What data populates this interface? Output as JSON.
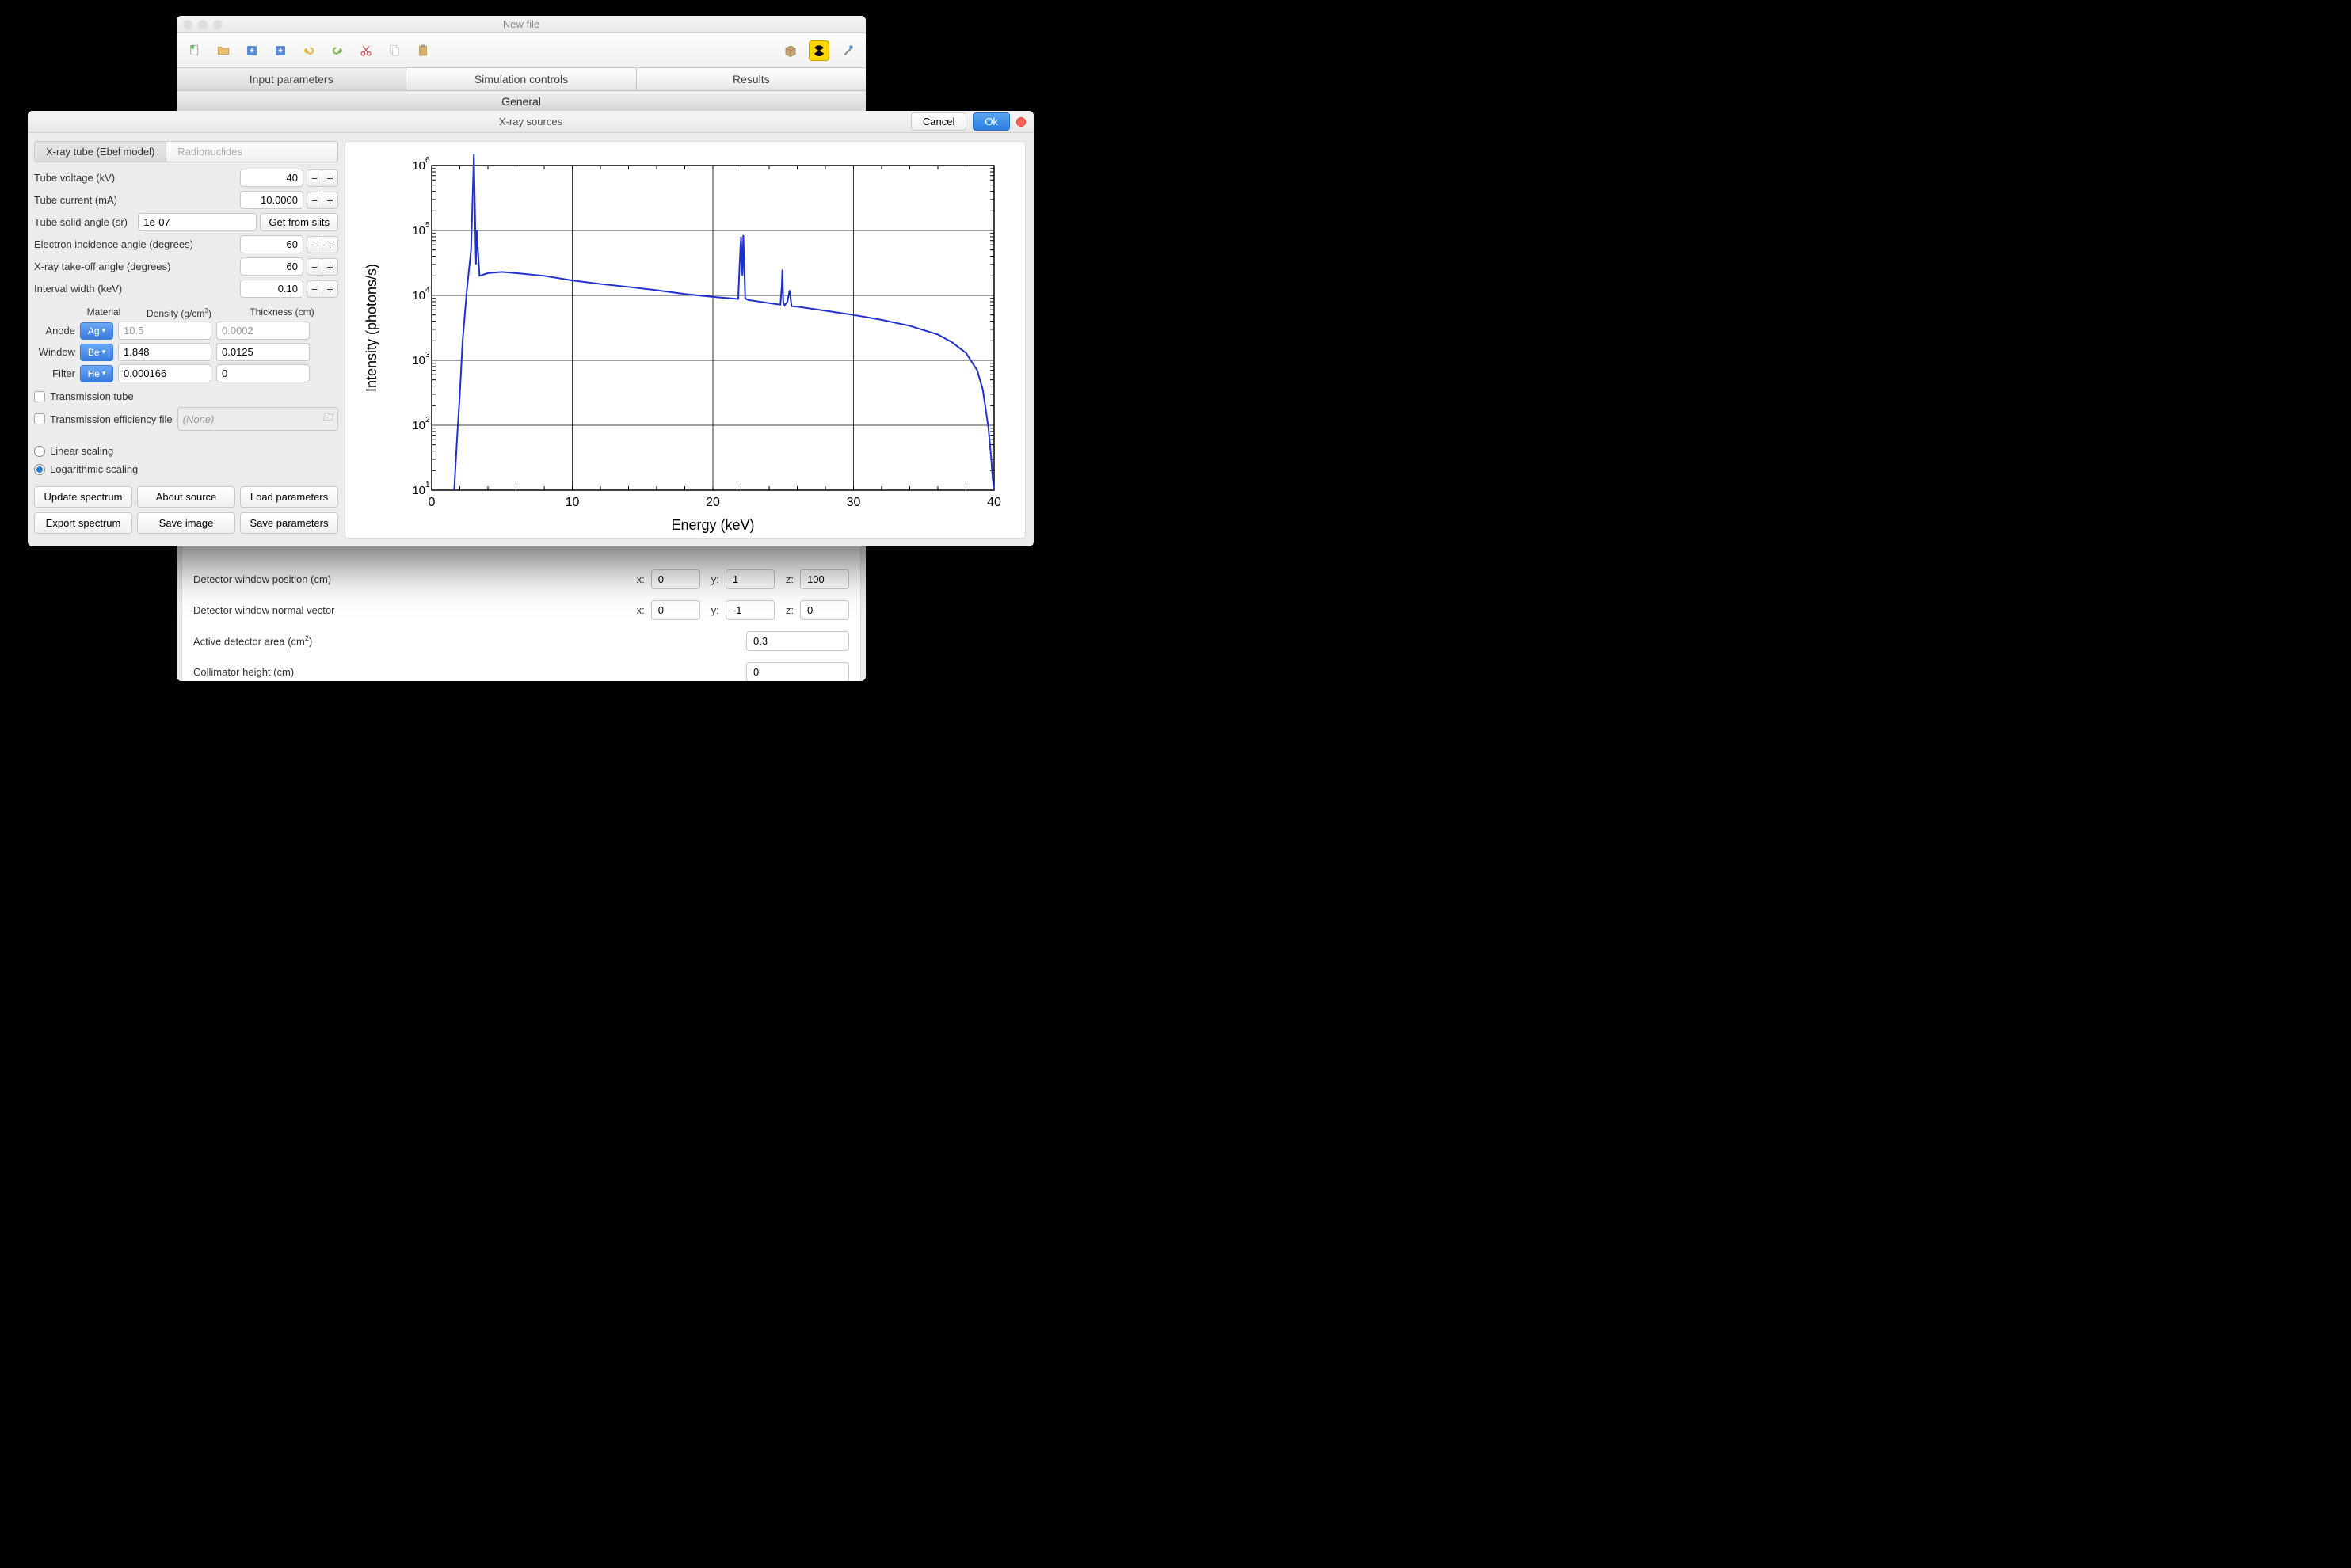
{
  "main_window": {
    "title": "New file",
    "tabs": [
      "Input parameters",
      "Simulation controls",
      "Results"
    ],
    "active_tab_index": 0,
    "section_header": "General",
    "detector_rows": [
      {
        "label": "Detector window position (cm)",
        "x": "0",
        "y": "1",
        "z": "100"
      },
      {
        "label": "Detector window normal vector",
        "x": "0",
        "y": "-1",
        "z": "0"
      }
    ],
    "area_label": "Active detector area (cm²)",
    "area_value": "0.3",
    "collimator_label": "Collimator height (cm)",
    "collimator_value": "0"
  },
  "dialog": {
    "title": "X-ray sources",
    "cancel": "Cancel",
    "ok": "Ok",
    "sub_tabs": [
      "X-ray tube (Ebel model)",
      "Radionuclides"
    ],
    "params": {
      "tube_voltage_label": "Tube voltage (kV)",
      "tube_voltage": "40",
      "tube_current_label": "Tube current (mA)",
      "tube_current": "10.0000",
      "solid_angle_label": "Tube solid angle (sr)",
      "solid_angle": "1e-07",
      "get_from_slits": "Get from slits",
      "electron_angle_label": "Electron incidence angle (degrees)",
      "electron_angle": "60",
      "takeoff_label": "X-ray take-off angle (degrees)",
      "takeoff": "60",
      "interval_label": "Interval width (keV)",
      "interval": "0.10"
    },
    "mat_headers": {
      "material": "Material",
      "density": "Density (g/cm³)",
      "thickness": "Thickness (cm)"
    },
    "materials": [
      {
        "row": "Anode",
        "mat": "Ag",
        "density": "10.5",
        "thickness": "0.0002",
        "density_gray": true,
        "thickness_gray": true
      },
      {
        "row": "Window",
        "mat": "Be",
        "density": "1.848",
        "thickness": "0.0125"
      },
      {
        "row": "Filter",
        "mat": "He",
        "density": "0.000166",
        "thickness": "0"
      }
    ],
    "transmission_tube": "Transmission tube",
    "trans_eff_file": "Transmission efficiency file",
    "none": "(None)",
    "linear": "Linear scaling",
    "log": "Logarithmic scaling",
    "buttons": [
      "Update spectrum",
      "About source",
      "Load parameters",
      "Export spectrum",
      "Save image",
      "Save parameters"
    ]
  },
  "chart_data": {
    "type": "line",
    "title": "",
    "xlabel": "Energy (keV)",
    "ylabel": "Intensity (photons/s)",
    "xlim": [
      0,
      40
    ],
    "ylim": [
      10.0,
      1000000.0
    ],
    "xticks": [
      0,
      10,
      20,
      30,
      40
    ],
    "yticks_exp": [
      1,
      2,
      3,
      4,
      5,
      6
    ],
    "yscale": "log",
    "series": [
      {
        "name": "spectrum",
        "color": "#2030d0",
        "x": [
          1.6,
          1.8,
          2.0,
          2.2,
          2.5,
          2.8,
          2.95,
          3.0,
          3.15,
          3.2,
          3.4,
          4.0,
          5.0,
          6.0,
          8.0,
          10.0,
          12.0,
          14.0,
          16.0,
          18.0,
          20.0,
          21.8,
          21.9,
          22.0,
          22.1,
          22.162,
          22.3,
          22.5,
          23.0,
          24.0,
          24.8,
          24.9,
          24.942,
          25.0,
          25.1,
          25.3,
          25.45,
          25.6,
          26.0,
          28.0,
          30.0,
          32.0,
          34.0,
          36.0,
          37.0,
          38.0,
          38.8,
          39.2,
          39.6,
          39.8,
          39.9,
          40.0
        ],
        "y": [
          10,
          60,
          300,
          2000,
          12000.0,
          50000.0,
          600000.0,
          1500000.0,
          30000.0,
          100000.0,
          20000.0,
          22000.0,
          23000.0,
          22000.0,
          20000.0,
          17000.0,
          15000.0,
          13500.0,
          12000.0,
          10500.0,
          9500.0,
          8800.0,
          30000.0,
          80000.0,
          20000.0,
          85000.0,
          9000.0,
          8500.0,
          8200.0,
          7600.0,
          7200.0,
          14000.0,
          25000.0,
          8000.0,
          7000.0,
          8000.0,
          12000.0,
          6800.0,
          6700.0,
          5800.0,
          5000.0,
          4200.0,
          3400.0,
          2500.0,
          1900.0,
          1300.0,
          700,
          350,
          90,
          30,
          15,
          10
        ]
      }
    ]
  }
}
